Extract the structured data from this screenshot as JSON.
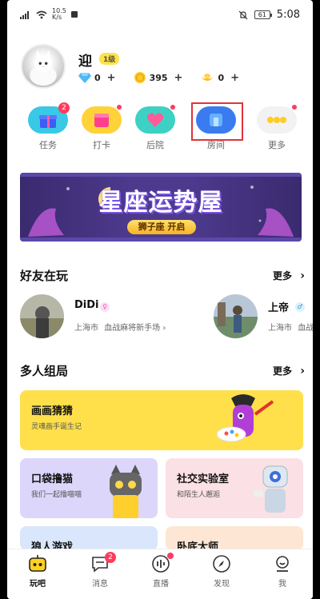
{
  "status_bar": {
    "speed_value": "10.5",
    "speed_unit": "K/s",
    "battery": "61",
    "time": "5:08"
  },
  "profile": {
    "username": "迎",
    "level": "1级",
    "diamonds": "0",
    "coins": "395",
    "shells": "0",
    "plus": "+"
  },
  "actions": [
    {
      "label": "任务",
      "badge": "2",
      "icon": "gift-icon",
      "color": "#39c8e6"
    },
    {
      "label": "打卡",
      "badge": "",
      "icon": "checkin-icon",
      "color": "#ffd23a"
    },
    {
      "label": "后院",
      "badge": "",
      "icon": "heart-icon",
      "color": "#3dd1c3"
    },
    {
      "label": "房间",
      "badge": "",
      "icon": "room-icon",
      "color": "#3a7bef"
    },
    {
      "label": "更多",
      "badge": "",
      "icon": "more-icon",
      "color": "#f2f2f2"
    }
  ],
  "banner": {
    "title": "星座运势屋",
    "button": "狮子座  开启"
  },
  "friends_section": {
    "title": "好友在玩",
    "more": "更多",
    "friends": [
      {
        "name": "DiDi",
        "gender_color": "#e88bd1",
        "gender_symbol": "♀",
        "location": "上海市",
        "activity": "血战麻将新手场 ›"
      },
      {
        "name": "上帝",
        "gender_color": "#59b6e8",
        "gender_symbol": "♂",
        "location": "上海市",
        "activity": "血战"
      }
    ]
  },
  "games_section": {
    "title": "多人组局",
    "more": "更多",
    "cards": [
      {
        "title": "画画猜猜",
        "subtitle": "灵魂画手诞生记",
        "color": "#ffe04a"
      },
      {
        "title": "口袋撸猫",
        "subtitle": "我们一起撸喵喵",
        "color": "#dcd6fb"
      },
      {
        "title": "社交实验室",
        "subtitle": "和陌生人邂逅",
        "color": "#fbe0e6"
      },
      {
        "title": "狼人游戏",
        "subtitle": "",
        "color": "#d9e6fb"
      },
      {
        "title": "卧底大师",
        "subtitle": "",
        "color": "#fde6d3"
      }
    ]
  },
  "tabbar": [
    {
      "label": "玩吧",
      "icon": "robot-icon",
      "badge": "",
      "dot": false,
      "active": true
    },
    {
      "label": "消息",
      "icon": "message-icon",
      "badge": "2",
      "dot": false,
      "active": false
    },
    {
      "label": "直播",
      "icon": "live-icon",
      "badge": "",
      "dot": true,
      "active": false
    },
    {
      "label": "发现",
      "icon": "compass-icon",
      "badge": "",
      "dot": false,
      "active": false
    },
    {
      "label": "我",
      "icon": "profile-icon",
      "badge": "",
      "dot": false,
      "active": false
    }
  ]
}
